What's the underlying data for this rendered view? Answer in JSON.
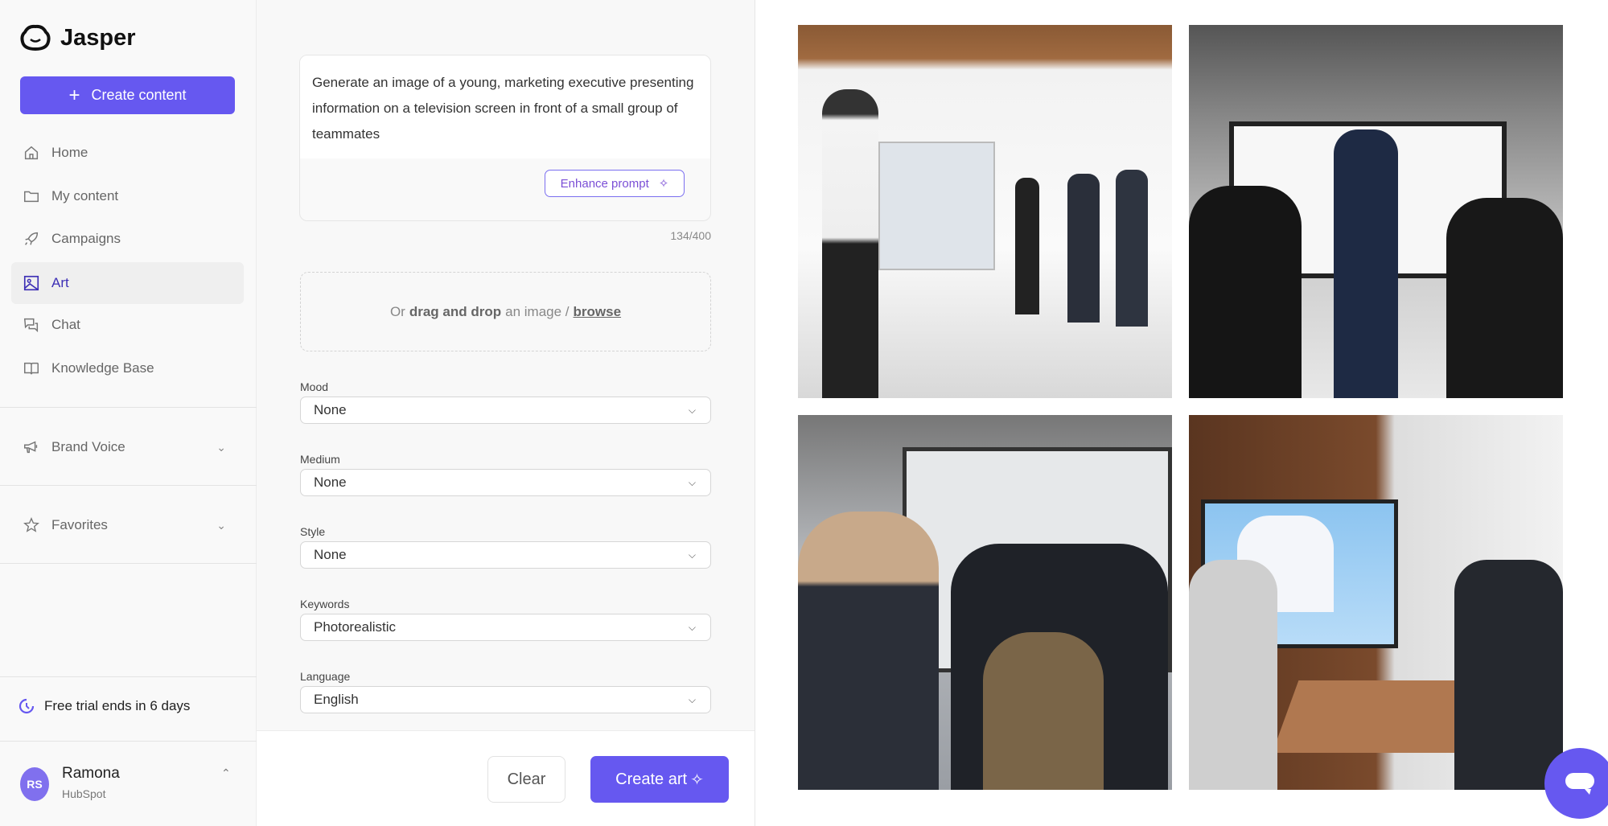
{
  "app": {
    "name": "Jasper",
    "accent": "#6658f0"
  },
  "sidebar": {
    "create_label": "Create content",
    "items": [
      {
        "label": "Home",
        "icon": "home-icon"
      },
      {
        "label": "My content",
        "icon": "folder-icon"
      },
      {
        "label": "Campaigns",
        "icon": "rocket-icon"
      },
      {
        "label": "Art",
        "icon": "image-icon",
        "active": true
      },
      {
        "label": "Chat",
        "icon": "chat-icon"
      },
      {
        "label": "Knowledge Base",
        "icon": "book-icon"
      }
    ],
    "sections": [
      {
        "label": "Brand Voice",
        "icon": "megaphone-icon"
      },
      {
        "label": "Favorites",
        "icon": "star-icon"
      }
    ],
    "trial": "Free trial ends in 6 days",
    "user": {
      "initials": "RS",
      "name": "Ramona",
      "org": "HubSpot"
    }
  },
  "form": {
    "prompt": "Generate an image of a young, marketing executive presenting information on a television screen in front of a small group of teammates",
    "enhance_label": "Enhance prompt",
    "count": "134/400",
    "drop": {
      "pre": "Or",
      "bold": "drag and drop",
      "mid": "an image /",
      "link": "browse"
    },
    "fields": [
      {
        "label": "Mood",
        "value": "None"
      },
      {
        "label": "Medium",
        "value": "None"
      },
      {
        "label": "Style",
        "value": "None"
      },
      {
        "label": "Keywords",
        "value": "Photorealistic"
      },
      {
        "label": "Language",
        "value": "English"
      }
    ],
    "clear_label": "Clear",
    "create_label": "Create art"
  }
}
